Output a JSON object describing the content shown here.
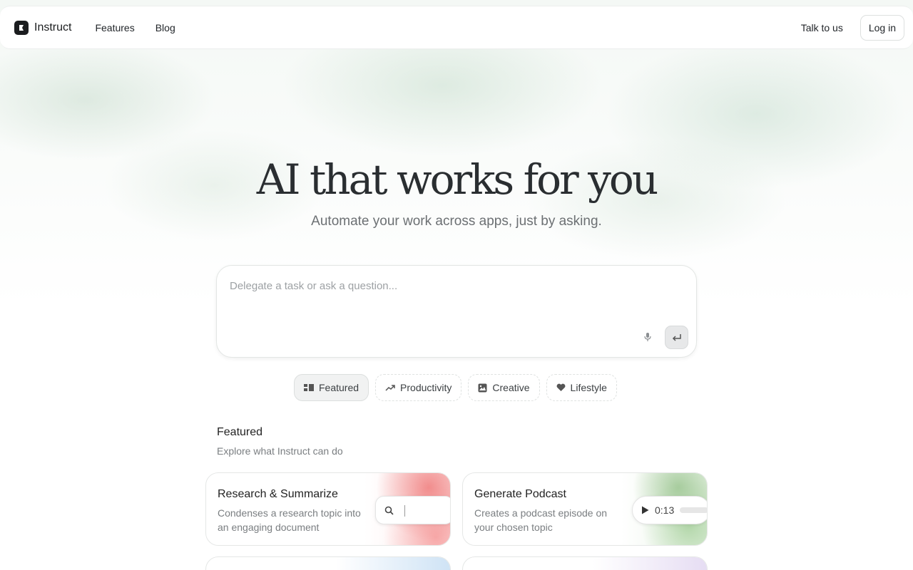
{
  "nav": {
    "brand": "Instruct",
    "links": [
      "Features",
      "Blog"
    ],
    "talk_label": "Talk to us",
    "login_label": "Log in"
  },
  "hero": {
    "title": "AI that works for you",
    "subtitle": "Automate your work across apps, just by asking."
  },
  "prompt": {
    "placeholder": "Delegate a task or ask a question...",
    "value": ""
  },
  "categories": [
    {
      "label": "Featured",
      "icon": "grid-icon",
      "active": true
    },
    {
      "label": "Productivity",
      "icon": "trending-up-icon",
      "active": false
    },
    {
      "label": "Creative",
      "icon": "image-icon",
      "active": false
    },
    {
      "label": "Lifestyle",
      "icon": "heart-icon",
      "active": false
    }
  ],
  "section": {
    "title": "Featured",
    "subtitle": "Explore what Instruct can do"
  },
  "cards": [
    {
      "title": "Research & Summarize",
      "desc": "Condenses a research topic into an engaging document"
    },
    {
      "title": "Generate Podcast",
      "desc": "Creates a podcast episode on your chosen topic",
      "player_time": "0:13"
    }
  ],
  "colors": {
    "accent": "#1b1d1f",
    "muted_text": "#7a7e81"
  }
}
